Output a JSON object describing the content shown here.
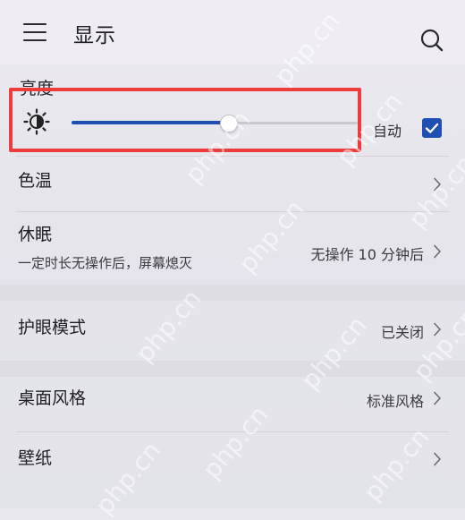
{
  "header": {
    "title": "显示"
  },
  "brightness": {
    "label": "亮度",
    "level": 0.55,
    "auto_label": "自动",
    "auto_checked": true
  },
  "rows": {
    "color_temp": {
      "title": "色温"
    },
    "sleep": {
      "title": "休眠",
      "subtitle": "一定时长无操作后，屏幕熄灭",
      "value": "无操作 10 分钟后"
    },
    "eye_comfort": {
      "title": "护眼模式",
      "value": "已关闭"
    },
    "desktop_style": {
      "title": "桌面风格",
      "value": "标准风格"
    },
    "wallpaper": {
      "title": "壁纸"
    }
  },
  "watermark": {
    "text": "php.cn"
  },
  "colors": {
    "accent": "#1f4fb0",
    "highlight": "#ee3b3b"
  },
  "icons": {
    "menu": "hamburger-menu-icon",
    "search": "search-icon",
    "brightness": "sun-icon",
    "check": "checkmark-icon",
    "chevron": "chevron-right-icon"
  }
}
